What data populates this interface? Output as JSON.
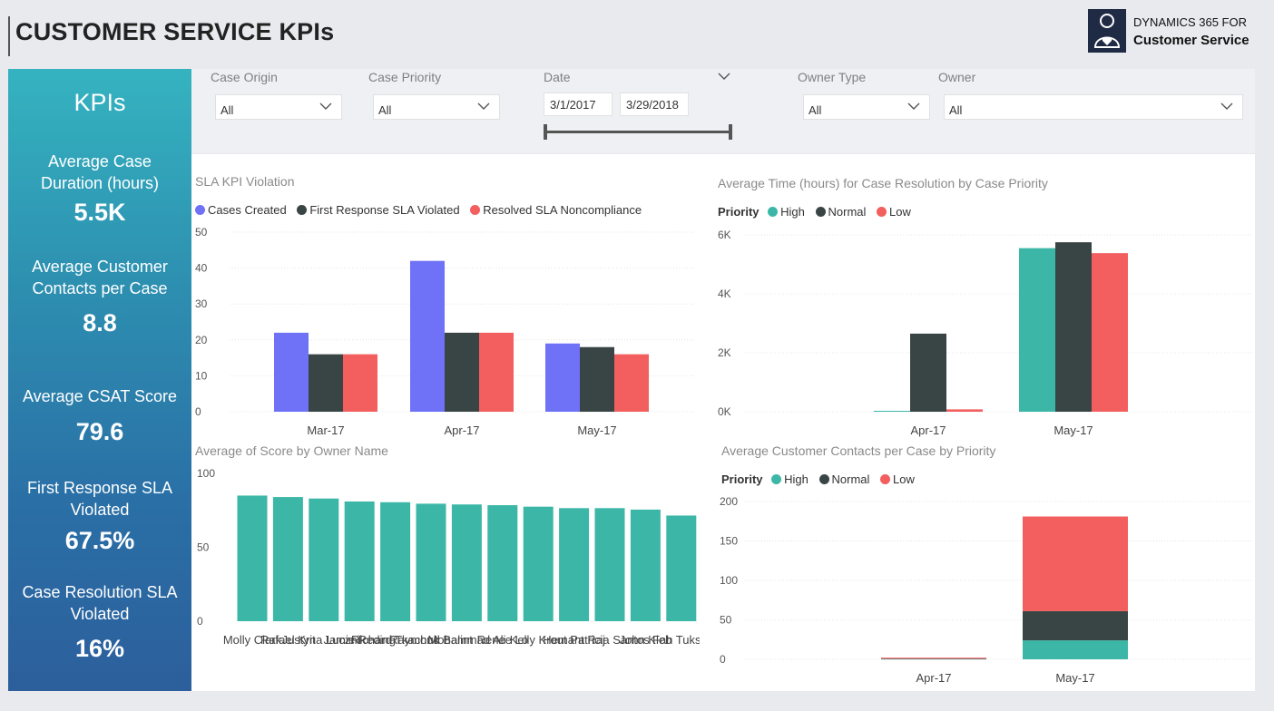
{
  "header": {
    "title": "CUSTOMER SERVICE KPIs",
    "brand_line1": "DYNAMICS 365 FOR",
    "brand_line2": "Customer Service"
  },
  "kpis": {
    "heading": "KPIs",
    "items": [
      {
        "label1": "Average Case",
        "label2": "Duration (hours)",
        "value": "5.5K"
      },
      {
        "label1": "Average Customer",
        "label2": "Contacts per Case",
        "value": "8.8"
      },
      {
        "label1": "Average CSAT Score",
        "label2": "",
        "value": "79.6"
      },
      {
        "label1": "First Response SLA",
        "label2": "Violated",
        "value": "67.5%"
      },
      {
        "label1": "Case Resolution SLA",
        "label2": "Violated",
        "value": "16%"
      }
    ]
  },
  "filters": {
    "case_origin": {
      "label": "Case Origin",
      "value": "All"
    },
    "case_priority": {
      "label": "Case Priority",
      "value": "All"
    },
    "date": {
      "label": "Date",
      "start": "3/1/2017",
      "end": "3/29/2018"
    },
    "owner_type": {
      "label": "Owner Type",
      "value": "All"
    },
    "owner": {
      "label": "Owner",
      "value": "All"
    }
  },
  "colors": {
    "blue": "#6f71f7",
    "dark": "#394444",
    "red": "#f25f5e",
    "teal": "#3cb7a7"
  },
  "chart_data": [
    {
      "id": "sla",
      "type": "bar",
      "title": "SLA KPI Violation",
      "categories": [
        "Mar-17",
        "Apr-17",
        "May-17"
      ],
      "series": [
        {
          "name": "Cases Created",
          "color": "#6f71f7",
          "values": [
            22,
            42,
            19
          ]
        },
        {
          "name": "First Response SLA Violated",
          "color": "#394444",
          "values": [
            16,
            22,
            18
          ]
        },
        {
          "name": "Resolved SLA Noncompliance",
          "color": "#f25f5e",
          "values": [
            16,
            22,
            16
          ]
        }
      ],
      "yticks": [
        0,
        10,
        20,
        30,
        40,
        50
      ],
      "ylim": [
        0,
        50
      ]
    },
    {
      "id": "restime",
      "type": "bar",
      "title": "Average Time (hours) for Case Resolution by Case Priority",
      "legend_title": "Priority",
      "categories": [
        "Apr-17",
        "May-17"
      ],
      "series": [
        {
          "name": "High",
          "color": "#3cb7a7",
          "values": [
            30,
            5550
          ]
        },
        {
          "name": "Normal",
          "color": "#394444",
          "values": [
            2650,
            5750
          ]
        },
        {
          "name": "Low",
          "color": "#f25f5e",
          "values": [
            80,
            5380
          ]
        }
      ],
      "yticks": [
        "0K",
        "2K",
        "4K",
        "6K"
      ],
      "ylim": [
        0,
        6000
      ]
    },
    {
      "id": "score",
      "type": "bar",
      "title": "Average of Score by Owner Name",
      "categories": [
        "Molly Clark",
        "Rafael Krit",
        "Justyna Lucznik",
        "Jamie Reding",
        "Richard Tkachuk",
        "Raymond Balint",
        "Mohammad Ali",
        "Renee Lo",
        "Kelly Krout",
        "Hemant Raj",
        "Patricia Santos",
        "John Kleb",
        "Fah Tuksin"
      ],
      "series": [
        {
          "name": "",
          "color": "#3cb7a7",
          "values": [
            85,
            84,
            83,
            81,
            80.5,
            79.5,
            79,
            78.5,
            77.5,
            76.5,
            76.5,
            75.5,
            71.5
          ]
        }
      ],
      "yticks": [
        0,
        50,
        100
      ],
      "ylim": [
        0,
        100
      ]
    },
    {
      "id": "contacts",
      "type": "bar",
      "stacked": true,
      "title": "Average Customer Contacts per Case by Priority",
      "legend_title": "Priority",
      "categories": [
        "Apr-17",
        "May-17"
      ],
      "series": [
        {
          "name": "High",
          "color": "#3cb7a7",
          "values": [
            0.5,
            24
          ]
        },
        {
          "name": "Normal",
          "color": "#394444",
          "values": [
            0.3,
            37
          ]
        },
        {
          "name": "Low",
          "color": "#f25f5e",
          "values": [
            1.2,
            120
          ]
        }
      ],
      "yticks": [
        0,
        50,
        100,
        150,
        200
      ],
      "ylim": [
        0,
        200
      ]
    }
  ]
}
